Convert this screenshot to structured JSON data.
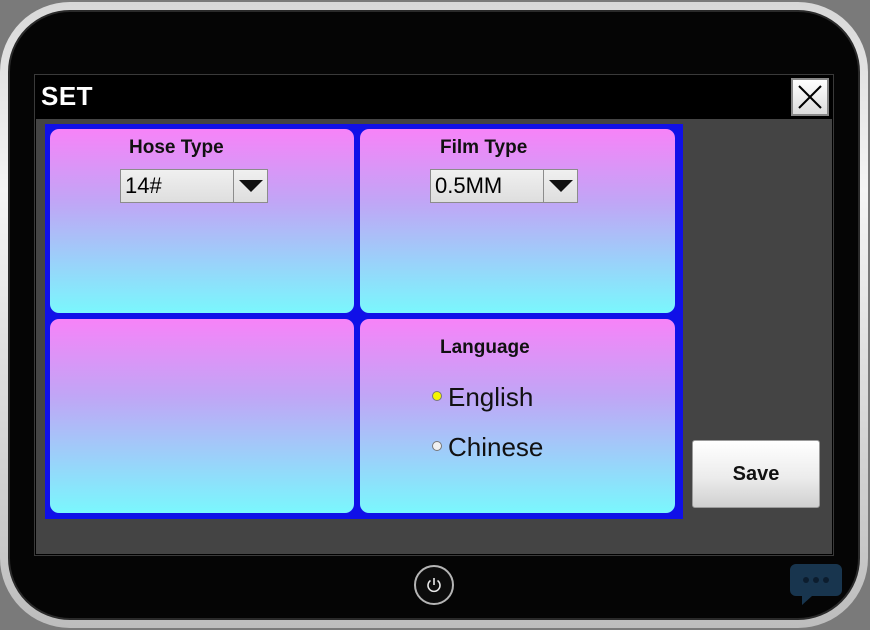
{
  "window": {
    "title": "SET"
  },
  "icons": {
    "close": "close-icon",
    "dropdown": "chevron-down-icon",
    "power": "power-icon",
    "chat": "chat-bubble-icon"
  },
  "panels": {
    "hose": {
      "heading": "Hose Type",
      "selected": "14#"
    },
    "film": {
      "heading": "Film Type",
      "selected": "0.5MM"
    },
    "language": {
      "heading": "Language",
      "options": [
        {
          "label": "English",
          "checked": true
        },
        {
          "label": "Chinese",
          "checked": false
        }
      ]
    }
  },
  "actions": {
    "save_label": "Save"
  },
  "colors": {
    "panel_top": "#f783f8",
    "panel_bottom": "#7af7fd",
    "grid_border": "#1010e8",
    "radio_checked": "#f5f500"
  }
}
